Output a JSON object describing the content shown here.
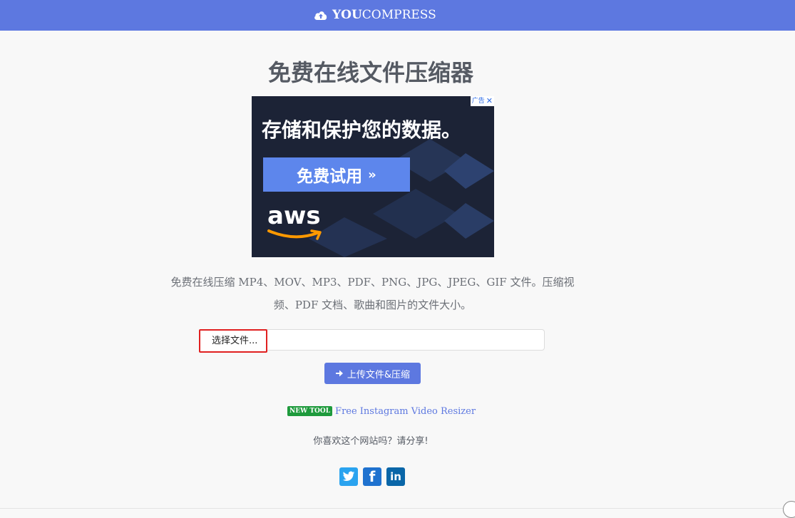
{
  "header": {
    "brand_bold": "YOU",
    "brand_regular": "COMPRESS",
    "bg_color": "#5d78e0"
  },
  "main": {
    "title": "免费在线文件压缩器",
    "description": "免费在线压缩 MP4、MOV、MP3、PDF、PNG、JPG、JPEG、GIF 文件。压缩视频、PDF 文档、歌曲和图片的文件大小。"
  },
  "ad": {
    "headline": "存储和保护您的数据。",
    "cta_label": "免费试用",
    "cta_arrow": "»",
    "logo_text": "aws",
    "adchoices_label": "广告",
    "close_label": "✕"
  },
  "upload": {
    "file_button_label": "选择文件...",
    "submit_label": "上传文件&压缩",
    "submit_icon": "arrow-right-icon"
  },
  "new_tool": {
    "badge": "NEW TOOL",
    "link_text": "Free Instagram Video Resizer"
  },
  "share": {
    "prompt": "你喜欢这个网站吗？请分享!",
    "networks": [
      "twitter",
      "facebook",
      "linkedin"
    ]
  },
  "colors": {
    "accent": "#5d78e0",
    "highlight_border": "#e02020",
    "badge_green": "#1e9a3c"
  }
}
